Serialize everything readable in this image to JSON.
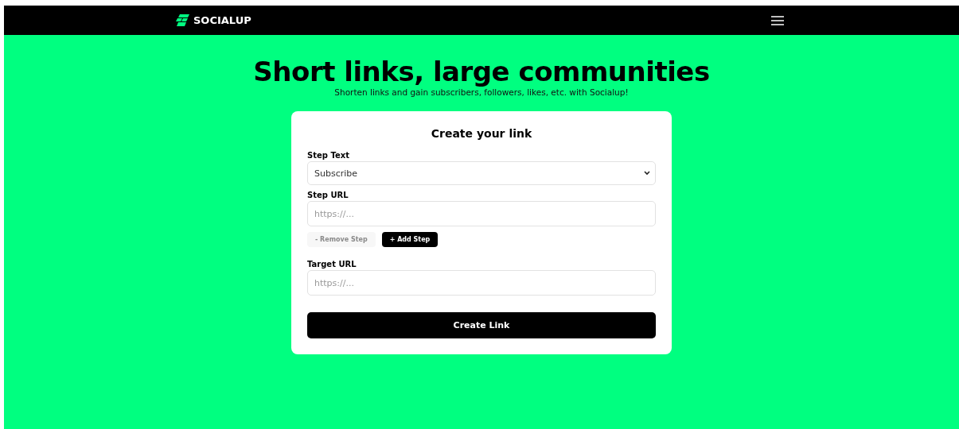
{
  "navbar": {
    "brand": "SOCIALUP"
  },
  "hero": {
    "title": "Short links, large communities",
    "subtitle": "Shorten links and gain subscribers, followers, likes, etc. with Socialup!"
  },
  "form": {
    "title": "Create your link",
    "step_text": {
      "label": "Step Text",
      "value": "Subscribe"
    },
    "step_url": {
      "label": "Step URL",
      "placeholder": "https://..."
    },
    "buttons": [
      {
        "label": "- Remove Step",
        "disabled": true
      },
      {
        "label": "+ Add Step",
        "disabled": false
      }
    ],
    "target_url": {
      "label": "Target URL",
      "placeholder": "https://..."
    },
    "submit": "Create Link"
  }
}
